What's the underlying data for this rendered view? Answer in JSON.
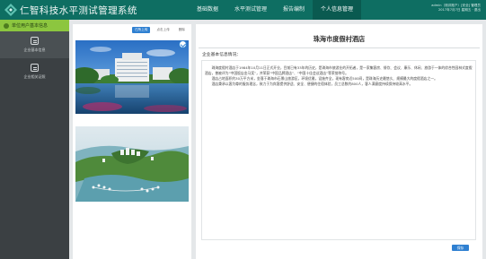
{
  "header": {
    "brand": "仁智科技水平测试管理系统",
    "nav": [
      {
        "label": "基础数据",
        "active": false
      },
      {
        "label": "水平测试管理",
        "active": false
      },
      {
        "label": "报告编制",
        "active": false
      },
      {
        "label": "个人信息管理",
        "active": true
      }
    ],
    "user": {
      "line1": "admin（测评账户）[安全] 管理员",
      "line2": "2017年7月7日 星期五 · 退出"
    }
  },
  "sidebar": {
    "title": "单位用户基本信息",
    "items": [
      {
        "label": "企业基本信息",
        "active": true
      },
      {
        "label": "企业相关证照",
        "active": false
      }
    ]
  },
  "image_panel": {
    "tabs": [
      {
        "label": "已所上传",
        "active": true
      },
      {
        "label": "点击上传",
        "active": false
      },
      {
        "label": "删除",
        "active": false
      }
    ],
    "images": [
      "hotel-waterfront-photo",
      "resort-aerial-rendering"
    ]
  },
  "company": {
    "name": "珠海市度假村酒店",
    "section_label": "企业基本信息情况：",
    "paragraphs": [
      "珠海度假村酒店于1984年10月11日正式开业，目前已有33年的历史，是珠海市旅游业的开拓者，是一家集客房、餐饮、会议、康乐、休闲、旅游于一体的综合性园林式度假酒店，曾被评为“中国饭店金马奖”，并荣获“中国品牌酒店”、“中国十佳会议酒店”等荣誉称号。",
      "酒店占地面积约30万平方米，坐落于珠海市石景山旅游区，环境优雅，设施齐全，现有客房近500间，是珠海历史最悠久、规模最大的度假酒店之一。",
      "酒店秉承以客为尊的服务理念，致力于为宾客提供舒适、安全、便捷的住宿体验，员工总数约800人，客人满意度持续保持较高水平。"
    ],
    "save_label": "保存"
  }
}
